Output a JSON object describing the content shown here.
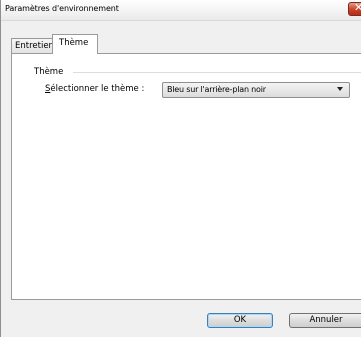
{
  "window": {
    "title": "Paramètres d'environnement",
    "close_glyph": "✕"
  },
  "tabs": [
    {
      "label": "Entretien",
      "active": false
    },
    {
      "label": "Thème",
      "active": true
    }
  ],
  "theme_group": {
    "title": "Thème",
    "select_label_mnemonic": "S",
    "select_label_rest": "électionner le thème :",
    "select_value": "Bleu sur l'arrière-plan noir"
  },
  "buttons": {
    "ok": "OK",
    "cancel": "Annuler"
  },
  "colors": {
    "close_button": "#c7432b",
    "default_button_border": "#3c7fb1"
  }
}
